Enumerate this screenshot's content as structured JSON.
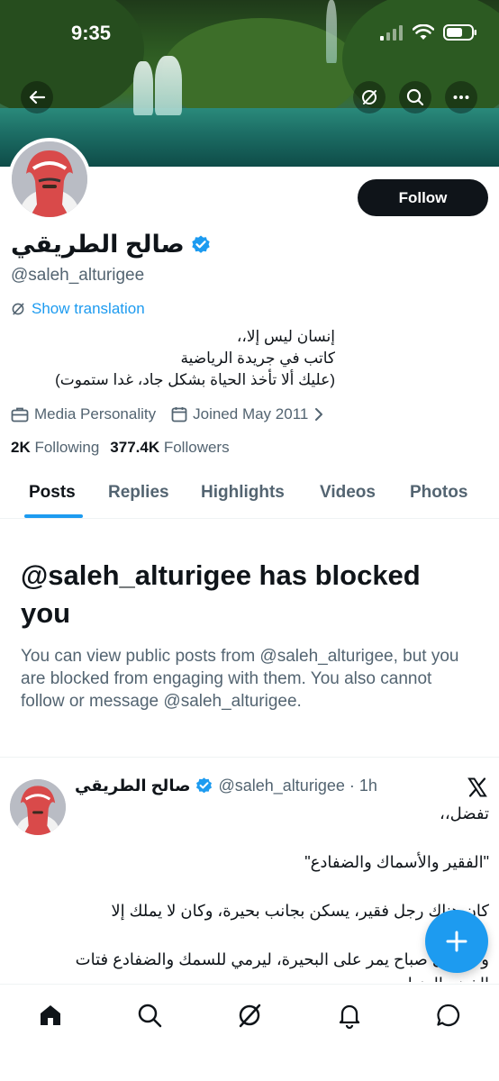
{
  "status_bar": {
    "time": "9:35"
  },
  "profile": {
    "display_name": "صالح الطريقي",
    "handle": "@saleh_alturigee",
    "follow_label": "Follow",
    "translation_label": "Show translation",
    "bio_lines": [
      "إنسان ليس إلا،،",
      "كاتب في جريدة الرياضية",
      "(عليك ألا تأخذ الحياة بشكل جاد، غدا ستموت)"
    ],
    "category": "Media Personality",
    "joined": "Joined May 2011",
    "following_count": "2K",
    "following_label": "Following",
    "followers_count": "377.4K",
    "followers_label": "Followers"
  },
  "tabs": [
    {
      "label": "Posts",
      "active": true
    },
    {
      "label": "Replies",
      "active": false
    },
    {
      "label": "Highlights",
      "active": false
    },
    {
      "label": "Videos",
      "active": false
    },
    {
      "label": "Photos",
      "active": false
    }
  ],
  "blocked": {
    "title": "@saleh_alturigee has blocked you",
    "description": "You can view public posts from @saleh_alturigee, but you are blocked from engaging with them. You also cannot follow or message @saleh_alturigee."
  },
  "post": {
    "name": "صالح الطريقي",
    "handle": "@saleh_alturigee",
    "time": "· 1h",
    "lines": [
      "تفضل،،",
      "\"الفقير والأسماك والضفادع\"",
      "كان هناك رجل فقير، يسكن بجانب بحيرة، وكان لا يملك إلا",
      "وكان كل صباح يمر على البحيرة، ليرمي للسمك والضفادع فتات الخبز والرز لهم"
    ]
  },
  "colors": {
    "accent": "#1d9bf0",
    "text": "#0f1419",
    "muted": "#536471"
  },
  "icons": [
    "back-arrow-icon",
    "grok-icon",
    "search-icon",
    "more-icon",
    "verified-badge-icon",
    "briefcase-icon",
    "calendar-icon",
    "chevron-right-icon",
    "x-logo-icon",
    "plus-icon",
    "home-icon",
    "notifications-icon",
    "messages-icon"
  ]
}
